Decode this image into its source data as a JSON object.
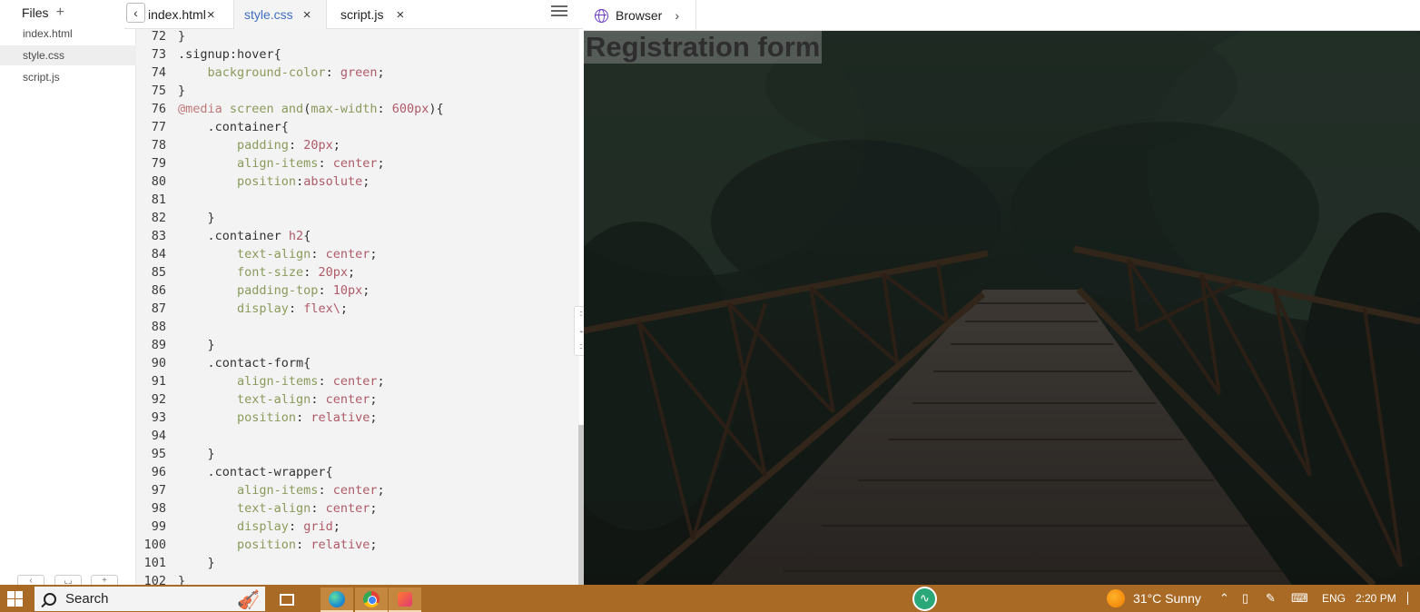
{
  "sidebar": {
    "header": "Files",
    "add_symbol": "+",
    "files": [
      "index.html",
      "style.css",
      "script.js"
    ],
    "active_file": "style.css"
  },
  "tabs": [
    {
      "label": "index.html",
      "close": "×"
    },
    {
      "label": "style.css",
      "close": "×"
    },
    {
      "label": "script.js",
      "close": "×"
    }
  ],
  "tab_back_symbol": "‹",
  "editor": {
    "lines": [
      {
        "n": "72",
        "tokens": [
          [
            "p",
            "}"
          ]
        ]
      },
      {
        "n": "73",
        "tokens": [
          [
            "sel",
            ".signup:hover{"
          ]
        ]
      },
      {
        "n": "74",
        "tokens": [
          [
            "p",
            "    "
          ],
          [
            "prop",
            "background-color"
          ],
          [
            "p",
            ": "
          ],
          [
            "val",
            "green"
          ],
          [
            "p",
            ";"
          ]
        ]
      },
      {
        "n": "75",
        "tokens": [
          [
            "p",
            "}"
          ]
        ]
      },
      {
        "n": "76",
        "tokens": [
          [
            "at",
            "@media"
          ],
          [
            "kw",
            " screen and"
          ],
          [
            "p",
            "("
          ],
          [
            "kw",
            "max-width"
          ],
          [
            "p",
            ": "
          ],
          [
            "val",
            "600px"
          ],
          [
            "p",
            "){"
          ]
        ]
      },
      {
        "n": "77",
        "tokens": [
          [
            "sel",
            "    .container{"
          ]
        ]
      },
      {
        "n": "78",
        "tokens": [
          [
            "p",
            "        "
          ],
          [
            "prop",
            "padding"
          ],
          [
            "p",
            ": "
          ],
          [
            "val",
            "20px"
          ],
          [
            "p",
            ";"
          ]
        ]
      },
      {
        "n": "79",
        "tokens": [
          [
            "p",
            "        "
          ],
          [
            "prop",
            "align-items"
          ],
          [
            "p",
            ": "
          ],
          [
            "val",
            "center"
          ],
          [
            "p",
            ";"
          ]
        ]
      },
      {
        "n": "80",
        "tokens": [
          [
            "p",
            "        "
          ],
          [
            "prop",
            "position"
          ],
          [
            "p",
            ":"
          ],
          [
            "val",
            "absolute"
          ],
          [
            "p",
            ";"
          ]
        ]
      },
      {
        "n": "81",
        "tokens": []
      },
      {
        "n": "82",
        "tokens": [
          [
            "p",
            "    }"
          ]
        ]
      },
      {
        "n": "83",
        "tokens": [
          [
            "sel",
            "    .container "
          ],
          [
            "tag",
            "h2"
          ],
          [
            "p",
            "{"
          ]
        ]
      },
      {
        "n": "84",
        "tokens": [
          [
            "p",
            "        "
          ],
          [
            "prop",
            "text-align"
          ],
          [
            "p",
            ": "
          ],
          [
            "val",
            "center"
          ],
          [
            "p",
            ";"
          ]
        ]
      },
      {
        "n": "85",
        "tokens": [
          [
            "p",
            "        "
          ],
          [
            "prop",
            "font-size"
          ],
          [
            "p",
            ": "
          ],
          [
            "val",
            "20px"
          ],
          [
            "p",
            ";"
          ]
        ]
      },
      {
        "n": "86",
        "tokens": [
          [
            "p",
            "        "
          ],
          [
            "prop",
            "padding-top"
          ],
          [
            "p",
            ": "
          ],
          [
            "val",
            "10px"
          ],
          [
            "p",
            ";"
          ]
        ]
      },
      {
        "n": "87",
        "tokens": [
          [
            "p",
            "        "
          ],
          [
            "prop",
            "display"
          ],
          [
            "p",
            ": "
          ],
          [
            "val",
            "flex\\"
          ],
          [
            "p",
            ";"
          ]
        ]
      },
      {
        "n": "88",
        "tokens": []
      },
      {
        "n": "89",
        "tokens": [
          [
            "p",
            "    }"
          ]
        ]
      },
      {
        "n": "90",
        "tokens": [
          [
            "sel",
            "    .contact-form{"
          ]
        ]
      },
      {
        "n": "91",
        "tokens": [
          [
            "p",
            "        "
          ],
          [
            "prop",
            "align-items"
          ],
          [
            "p",
            ": "
          ],
          [
            "val",
            "center"
          ],
          [
            "p",
            ";"
          ]
        ]
      },
      {
        "n": "92",
        "tokens": [
          [
            "p",
            "        "
          ],
          [
            "prop",
            "text-align"
          ],
          [
            "p",
            ": "
          ],
          [
            "val",
            "center"
          ],
          [
            "p",
            ";"
          ]
        ]
      },
      {
        "n": "93",
        "tokens": [
          [
            "p",
            "        "
          ],
          [
            "prop",
            "position"
          ],
          [
            "p",
            ": "
          ],
          [
            "val",
            "relative"
          ],
          [
            "p",
            ";"
          ]
        ]
      },
      {
        "n": "94",
        "tokens": []
      },
      {
        "n": "95",
        "tokens": [
          [
            "p",
            "    }"
          ]
        ]
      },
      {
        "n": "96",
        "tokens": [
          [
            "sel",
            "    .contact-wrapper{"
          ]
        ]
      },
      {
        "n": "97",
        "tokens": [
          [
            "p",
            "        "
          ],
          [
            "prop",
            "align-items"
          ],
          [
            "p",
            ": "
          ],
          [
            "val",
            "center"
          ],
          [
            "p",
            ";"
          ]
        ]
      },
      {
        "n": "98",
        "tokens": [
          [
            "p",
            "        "
          ],
          [
            "prop",
            "text-align"
          ],
          [
            "p",
            ": "
          ],
          [
            "val",
            "center"
          ],
          [
            "p",
            ";"
          ]
        ]
      },
      {
        "n": "99",
        "tokens": [
          [
            "p",
            "        "
          ],
          [
            "prop",
            "display"
          ],
          [
            "p",
            ": "
          ],
          [
            "val",
            "grid"
          ],
          [
            "p",
            ";"
          ]
        ]
      },
      {
        "n": "100",
        "tokens": [
          [
            "p",
            "        "
          ],
          [
            "prop",
            "position"
          ],
          [
            "p",
            ": "
          ],
          [
            "val",
            "relative"
          ],
          [
            "p",
            ";"
          ]
        ]
      },
      {
        "n": "101",
        "tokens": [
          [
            "p",
            "    }"
          ]
        ]
      },
      {
        "n": "102",
        "tokens": [
          [
            "p",
            "}"
          ]
        ]
      }
    ]
  },
  "splitter": {
    "top": "∷",
    "middle": "↔",
    "bottom": "∷"
  },
  "browser": {
    "tab_label": "Browser",
    "chevron": "›",
    "page_heading": "Registration form"
  },
  "taskbar": {
    "search_label": "Search",
    "weather": "31°C  Sunny",
    "language": "ENG",
    "time": "2:20 PM"
  },
  "colors": {
    "taskbar_bg": "#a86a24",
    "active_tab_text": "#3f6fc0",
    "editor_bg": "#f3f3f3"
  },
  "icons": [
    "plus-icon",
    "chevron-left-icon",
    "close-icon",
    "hamburger-menu-icon",
    "globe-icon",
    "chevron-right-icon",
    "windows-start-icon",
    "search-icon",
    "task-view-icon",
    "edge-icon",
    "chrome-icon",
    "app-icon",
    "pulse-icon",
    "weather-sun-icon",
    "chevron-up-icon",
    "keyboard-icon"
  ]
}
